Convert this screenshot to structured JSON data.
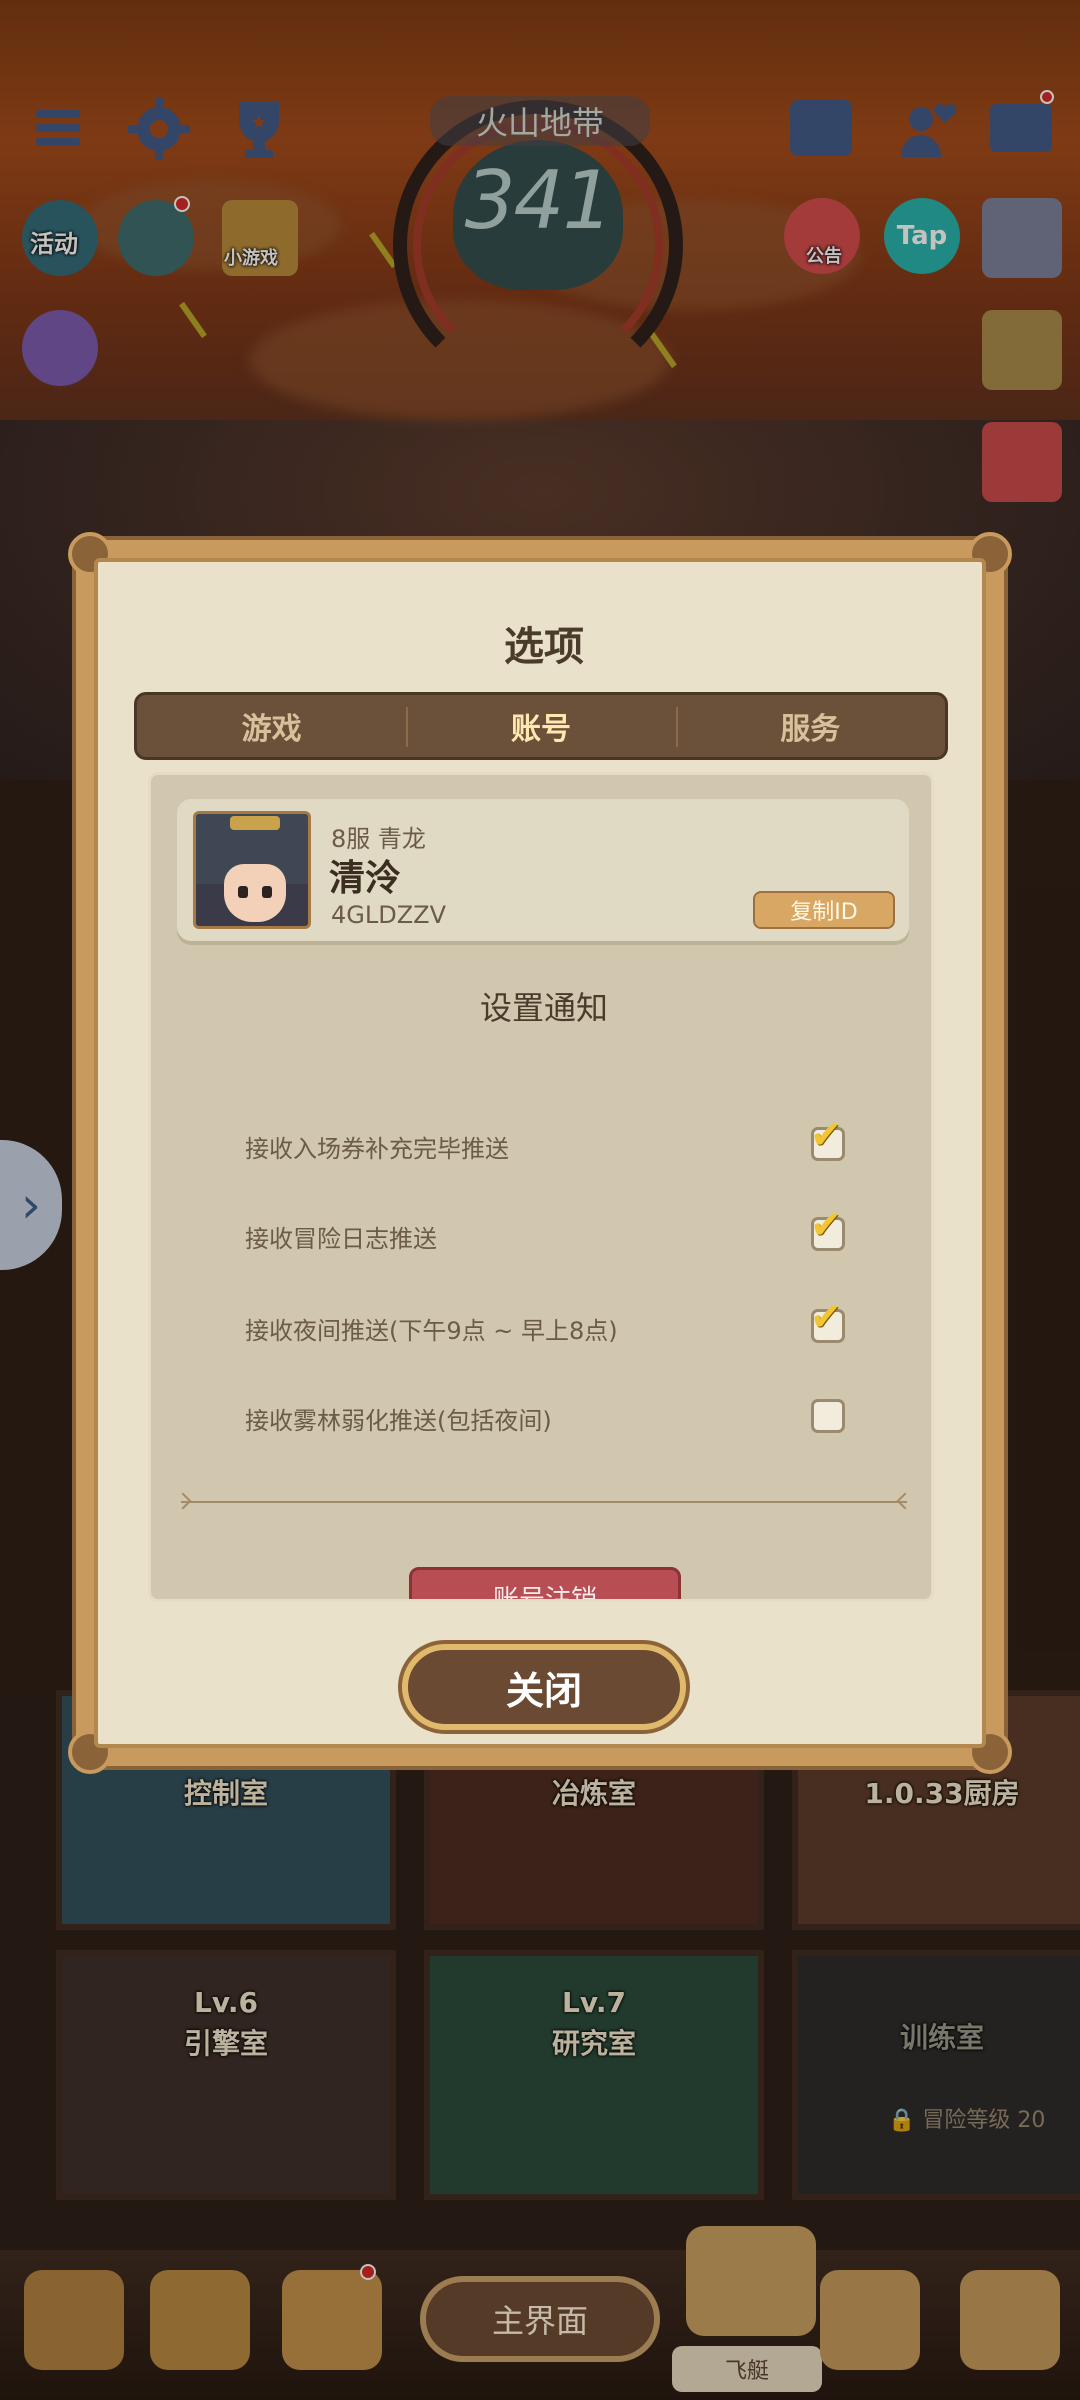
{
  "zone": {
    "name": "火山地带",
    "depth": "341"
  },
  "top_icons": {
    "activity_label": "活动",
    "minigame_label": "小游戏",
    "notice_label": "公告",
    "tap_label": "Tap"
  },
  "modal": {
    "title": "选项",
    "tabs": [
      {
        "label": "游戏",
        "active": false
      },
      {
        "label": "账号",
        "active": true
      },
      {
        "label": "服务",
        "active": false
      }
    ],
    "profile": {
      "server": "8服 青龙",
      "name": "清泠",
      "id": "4GLDZZV",
      "copy_label": "复制ID"
    },
    "notifications": {
      "title": "设置通知",
      "items": [
        {
          "label": "接收入场券补充完毕推送",
          "checked": true
        },
        {
          "label": "接收冒险日志推送",
          "checked": true
        },
        {
          "label": "接收夜间推送(下午9点 ~ 早上8点)",
          "checked": true
        },
        {
          "label": "接收雾林弱化推送(包括夜间)",
          "checked": false
        }
      ]
    },
    "cancel_account_label": "账号注销",
    "close_label": "关闭"
  },
  "rooms": {
    "control": "控制室",
    "smelting": "冶炼室",
    "kitchen": "厨房",
    "version": "1.0.33",
    "engine_lv": "Lv.6",
    "engine": "引擎室",
    "research_lv": "Lv.7",
    "research": "研究室",
    "training": "训练室",
    "training_lock": "冒险等级 20"
  },
  "bottom_nav": {
    "main_label": "主界面",
    "airship_label": "飞艇"
  },
  "colors": {
    "modal_bg": "#e9e1c9",
    "frame": "#c99a5e",
    "tab_bar": "#6b5139",
    "cancel": "#b84e53",
    "check": "#f2c531"
  }
}
